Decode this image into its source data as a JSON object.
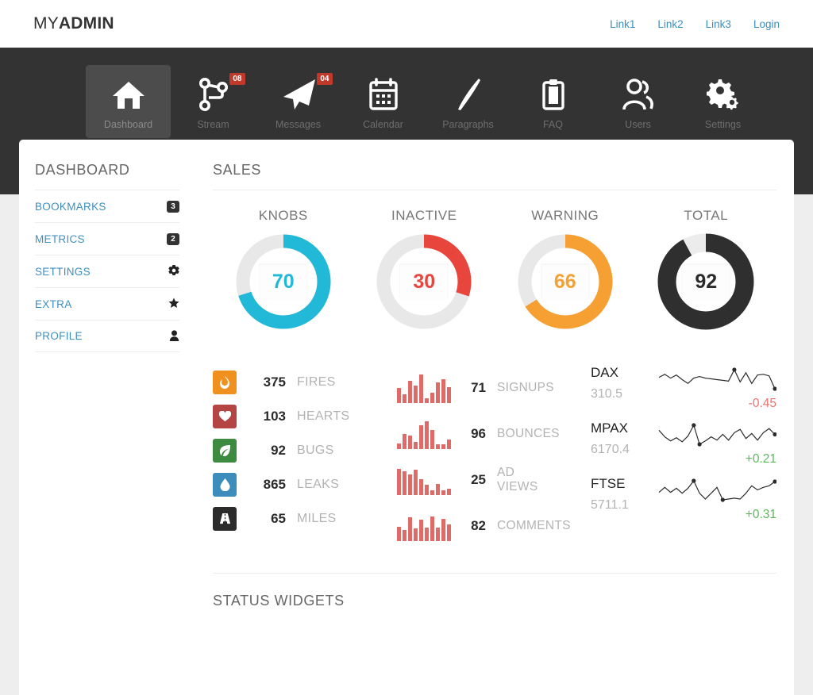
{
  "header": {
    "brand_light": "MY",
    "brand_bold": "ADMIN",
    "links": [
      {
        "label": "Link1"
      },
      {
        "label": "Link2"
      },
      {
        "label": "Link3"
      },
      {
        "label": "Login"
      }
    ]
  },
  "nav": {
    "items": [
      {
        "label": "Dashboard",
        "icon": "home-icon",
        "badge": null,
        "active": true
      },
      {
        "label": "Stream",
        "icon": "share-nodes-icon",
        "badge": "08",
        "active": false
      },
      {
        "label": "Messages",
        "icon": "paper-plane-icon",
        "badge": "04",
        "active": false
      },
      {
        "label": "Calendar",
        "icon": "calendar-icon",
        "badge": null,
        "active": false
      },
      {
        "label": "Paragraphs",
        "icon": "feather-pen-icon",
        "badge": null,
        "active": false
      },
      {
        "label": "FAQ",
        "icon": "clipboard-icon",
        "badge": null,
        "active": false
      },
      {
        "label": "Users",
        "icon": "users-icon",
        "badge": null,
        "active": false
      },
      {
        "label": "Settings",
        "icon": "gears-icon",
        "badge": null,
        "active": false
      }
    ]
  },
  "sidebar": {
    "title": "DASHBOARD",
    "items": [
      {
        "label": "BOOKMARKS",
        "count": "3",
        "icon": null
      },
      {
        "label": "METRICS",
        "count": "2",
        "icon": null
      },
      {
        "label": "SETTINGS",
        "count": null,
        "icon": "gear-icon"
      },
      {
        "label": "EXTRA",
        "count": null,
        "icon": "star-icon"
      },
      {
        "label": "PROFILE",
        "count": null,
        "icon": "user-icon"
      }
    ]
  },
  "main": {
    "section_title": "SALES",
    "bottom_section_title": "STATUS WIDGETS"
  },
  "chart_data": [
    {
      "type": "pie",
      "title": "KNOBS",
      "value": 70,
      "max": 100,
      "color": "#22b8d8",
      "track_color": "#e8e8e8",
      "thickness": 17
    },
    {
      "type": "pie",
      "title": "INACTIVE",
      "value": 30,
      "max": 100,
      "color": "#e8453c",
      "track_color": "#e8e8e8",
      "thickness": 17
    },
    {
      "type": "pie",
      "title": "WARNING",
      "value": 66,
      "max": 100,
      "color": "#f6a033",
      "track_color": "#e8e8e8",
      "thickness": 17
    },
    {
      "type": "pie",
      "title": "TOTAL",
      "value": 92,
      "max": 100,
      "color": "#2f2f2f",
      "track_color": "#ececec",
      "thickness": 23
    },
    {
      "type": "bar",
      "title": "SIGNUPS",
      "label": "SIGNUPS",
      "total": "71",
      "values": [
        52,
        30,
        78,
        62,
        100,
        12,
        36,
        72,
        84,
        56
      ],
      "color": "#d9534f",
      "ylim": [
        0,
        100
      ]
    },
    {
      "type": "bar",
      "title": "BOUNCES",
      "label": "BOUNCES",
      "total": "96",
      "values": [
        20,
        52,
        48,
        24,
        84,
        96,
        66,
        8,
        10,
        32
      ],
      "color": "#d9534f",
      "ylim": [
        0,
        100
      ]
    },
    {
      "type": "bar",
      "title": "AD VIEWS",
      "label_line1": "AD",
      "label_line2": "VIEWS",
      "total": "25",
      "values": [
        92,
        84,
        72,
        88,
        56,
        36,
        12,
        40,
        16,
        22
      ],
      "color": "#d9534f",
      "ylim": [
        0,
        100
      ]
    },
    {
      "type": "bar",
      "title": "COMMENTS",
      "label": "COMMENTS",
      "total": "82",
      "values": [
        50,
        40,
        82,
        44,
        74,
        48,
        86,
        46,
        78,
        58
      ],
      "color": "#d9534f",
      "ylim": [
        0,
        100
      ]
    },
    {
      "type": "line",
      "title": "DAX",
      "name": "DAX",
      "price": "310.5",
      "change": "-0.45",
      "direction": "down",
      "color": "#2b2b2b",
      "values": [
        52,
        60,
        50,
        58,
        46,
        36,
        50,
        54,
        50,
        48,
        46,
        44,
        42,
        72,
        40,
        64,
        36,
        58,
        60,
        56,
        22
      ],
      "markers": [
        13,
        20
      ]
    },
    {
      "type": "line",
      "title": "MPAX",
      "name": "MPAX",
      "price": "6170.4",
      "change": "+0.21",
      "direction": "up",
      "color": "#2b2b2b",
      "values": [
        64,
        48,
        38,
        46,
        36,
        50,
        76,
        30,
        38,
        48,
        40,
        54,
        40,
        58,
        66,
        44,
        56,
        40,
        58,
        68,
        54
      ],
      "markers": [
        6,
        7,
        20
      ]
    },
    {
      "type": "line",
      "title": "FTSE",
      "name": "FTSE",
      "price": "5711.1",
      "change": "+0.31",
      "direction": "up",
      "color": "#2b2b2b",
      "values": [
        46,
        58,
        46,
        56,
        44,
        56,
        74,
        44,
        30,
        44,
        58,
        28,
        30,
        32,
        30,
        44,
        62,
        52,
        58,
        62,
        72
      ],
      "markers": [
        6,
        11,
        20
      ]
    }
  ],
  "stats": {
    "icon_items": [
      {
        "value": "375",
        "label": "FIRES",
        "icon": "fire-icon",
        "color": "#f0911f"
      },
      {
        "value": "103",
        "label": "HEARTS",
        "icon": "heart-icon",
        "color": "#b54545"
      },
      {
        "value": "92",
        "label": "BUGS",
        "icon": "leaf-icon",
        "color": "#3d8b40"
      },
      {
        "value": "865",
        "label": "LEAKS",
        "icon": "droplet-icon",
        "color": "#3c8dbc"
      },
      {
        "value": "65",
        "label": "MILES",
        "icon": "road-icon",
        "color": "#2b2b2b"
      }
    ]
  }
}
